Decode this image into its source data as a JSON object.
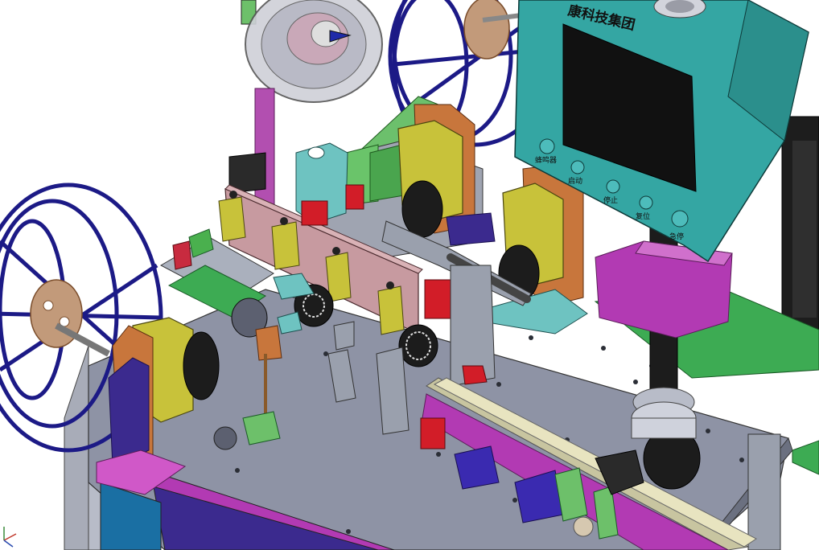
{
  "brand_text": "康科技集团",
  "buttons": [
    {
      "label": "蜂鸣器"
    },
    {
      "label": "启动"
    },
    {
      "label": "停止"
    },
    {
      "label": "复位"
    },
    {
      "label": "急停"
    }
  ],
  "colors": {
    "reel_blue": "#1c1a86",
    "panel_teal": "#34a6a3",
    "magenta": "#b23ab3",
    "yellow_motor": "#c8c23a",
    "pink_plate": "#c79aa0",
    "orange_wood": "#c8763c",
    "table_top": "#8e93a5",
    "green_rail": "#3dab53",
    "black_drum": "#1c1c1c",
    "red_block": "#d21d28",
    "purple_support": "#3b2a8e"
  }
}
